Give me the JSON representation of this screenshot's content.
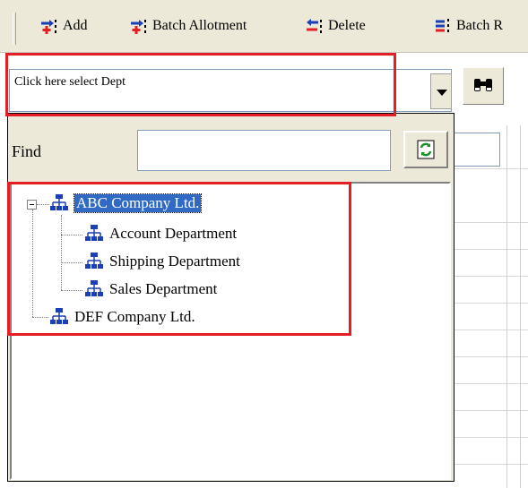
{
  "toolbar": {
    "add_label": "Add",
    "batch_allotment_label": "Batch Allotment",
    "delete_label": "Delete",
    "batch_r_label": "Batch R"
  },
  "dept_selector": {
    "placeholder_text": "Click here select Dept"
  },
  "find": {
    "label": "Find",
    "value": ""
  },
  "tree": {
    "root1": {
      "label": "ABC Company Ltd.",
      "children": [
        "Account Department",
        "Shipping Department",
        "Sales Department"
      ]
    },
    "root2": {
      "label": "DEF Company Ltd."
    }
  },
  "colors": {
    "highlight": "#e31e24",
    "selection": "#316ac5",
    "chrome": "#ece9d8",
    "icon_blue": "#1b3fb5"
  },
  "icons": [
    "add-icon",
    "batch-allotment-icon",
    "delete-icon",
    "batch-r-icon",
    "dropdown-arrow-icon",
    "binoculars-icon",
    "refresh-icon",
    "org-chart-icon",
    "collapse-toggle-icon"
  ]
}
